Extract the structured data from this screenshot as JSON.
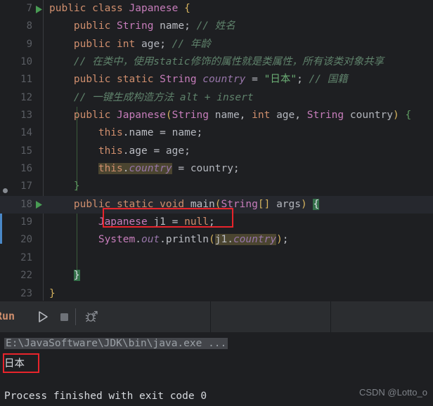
{
  "editor": {
    "first_line": 7,
    "lines": [
      {
        "n": 7,
        "run_marker": true,
        "current": false,
        "change": false
      },
      {
        "n": 8,
        "run_marker": false,
        "current": false,
        "change": false
      },
      {
        "n": 9,
        "run_marker": false,
        "current": false,
        "change": false
      },
      {
        "n": 10,
        "run_marker": false,
        "current": false,
        "change": false
      },
      {
        "n": 11,
        "run_marker": false,
        "current": false,
        "change": false
      },
      {
        "n": 12,
        "run_marker": false,
        "current": false,
        "change": false
      },
      {
        "n": 13,
        "run_marker": false,
        "current": false,
        "change": false
      },
      {
        "n": 14,
        "run_marker": false,
        "current": false,
        "change": false
      },
      {
        "n": 15,
        "run_marker": false,
        "current": false,
        "change": false
      },
      {
        "n": 16,
        "run_marker": false,
        "current": false,
        "change": false
      },
      {
        "n": 17,
        "run_marker": false,
        "current": false,
        "change": false
      },
      {
        "n": 18,
        "run_marker": true,
        "current": true,
        "change": false
      },
      {
        "n": 19,
        "run_marker": false,
        "current": false,
        "change": true
      },
      {
        "n": 20,
        "run_marker": false,
        "current": false,
        "change": true
      },
      {
        "n": 21,
        "run_marker": false,
        "current": false,
        "change": false
      },
      {
        "n": 22,
        "run_marker": false,
        "current": false,
        "change": false
      },
      {
        "n": 23,
        "run_marker": false,
        "current": false,
        "change": false
      }
    ],
    "code_text": [
      "public class Japanese {",
      "    public String name; // 姓名",
      "    public int age; // 年龄",
      "    // 在类中，使用static修饰的属性就是类属性，所有该类对象共享",
      "    public static String country = \"日本\"; // 国籍",
      "    // 一键生成构造方法 alt + insert",
      "    public Japanese(String name, int age, String country) {",
      "        this.name = name;",
      "        this.age = age;",
      "        this.country = country;",
      "    }",
      "    public static void main(String[] args) {",
      "        Japanese j1 = null;",
      "        System.out.println(j1.country);",
      "",
      "    }",
      "}"
    ],
    "annotations": [
      {
        "name": "null-assignment-highlight",
        "target": "Japanese j1 = null;",
        "color": "#e8242b"
      }
    ]
  },
  "run_panel": {
    "title": "Run",
    "buttons": [
      {
        "name": "rerun-button",
        "icon": "play-icon",
        "label": "Rerun"
      },
      {
        "name": "stop-button",
        "icon": "stop-icon",
        "label": "Stop"
      },
      {
        "name": "debug-button",
        "icon": "bug-icon",
        "label": "Debug"
      }
    ],
    "console": {
      "command_line": "E:\\JavaSoftware\\JDK\\bin\\java.exe ...",
      "output_line": "日本",
      "exit_line": "Process finished with exit code 0",
      "output_highlight_color": "#e8242b"
    }
  },
  "watermark": "CSDN @Lotto_o"
}
